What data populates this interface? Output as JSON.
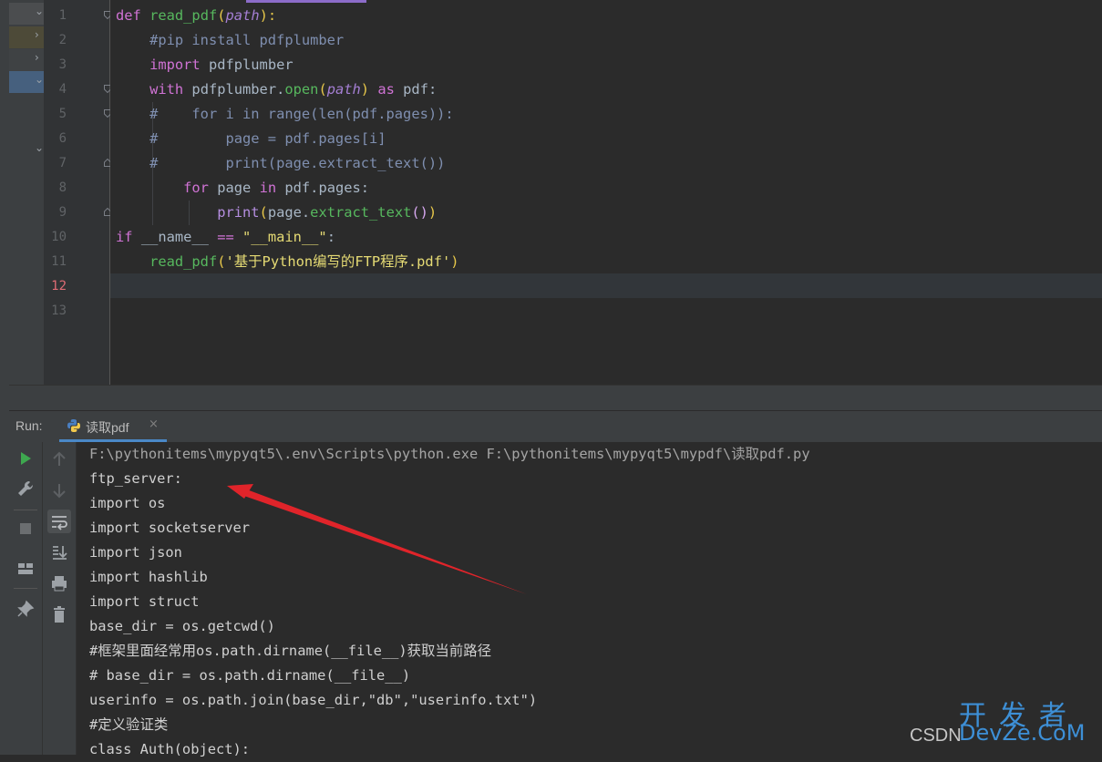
{
  "editor": {
    "current_line": 12,
    "line_numbers": [
      "1",
      "2",
      "3",
      "4",
      "5",
      "6",
      "7",
      "8",
      "9",
      "10",
      "11",
      "12",
      "13"
    ],
    "code": {
      "l1_kw": "def",
      "l1_fn": "read_pdf",
      "l1_open": "(",
      "l1_param": "path",
      "l1_close": "):",
      "l2_comment": "#pip install pdfplumber",
      "l3_kw": "import",
      "l3_rest": " pdfplumber",
      "l4_kw": "with",
      "l4_obj": " pdfplumber.",
      "l4_fn": "open",
      "l4_open": "(",
      "l4_param": "path",
      "l4_close": ")",
      "l4_as": " as",
      "l4_rest": " pdf:",
      "l5_comment": "#    for i in range(len(pdf.pages)):",
      "l6_comment": "#        page = pdf.pages[i]",
      "l7_comment": "#        print(page.extract_text())",
      "l8_kw": "for",
      "l8_mid": " page ",
      "l8_in": "in",
      "l8_rest": " pdf.pages:",
      "l9_fn": "print",
      "l9_open": "(",
      "l9_mid": "page.",
      "l9_call": "extract_text",
      "l9_parens": "()",
      "l9_close": ")",
      "l10_kw": "if",
      "l10_mid": " __name__ ",
      "l10_op": "==",
      "l10_str": " \"__main__\"",
      "l10_colon": ":",
      "l11_fn": "read_pdf",
      "l11_open": "(",
      "l11_str": "'基于Python编写的FTP程序.pdf'",
      "l11_close": ")"
    }
  },
  "run_panel": {
    "label": "Run:",
    "tab_label": "读取pdf",
    "tab_close": "×",
    "tab_icon": "python-icon",
    "console_lines": [
      "F:\\pythonitems\\mypyqt5\\.env\\Scripts\\python.exe F:\\pythonitems\\mypyqt5\\mypdf\\读取pdf.py",
      "ftp_server:",
      "import os",
      "import socketserver",
      "import json",
      "import hashlib",
      "import struct",
      "base_dir = os.getcwd()",
      "#框架里面经常用os.path.dirname(__file__)获取当前路径",
      "# base_dir = os.path.dirname(__file__)",
      "userinfo = os.path.join(base_dir,\"db\",\"userinfo.txt\")",
      "#定义验证类",
      "class Auth(object):"
    ],
    "toolbar_icons": [
      "rerun-icon",
      "wrench-icon",
      "stop-icon",
      "layout-icon",
      "pin-icon"
    ],
    "toolbar2_icons": [
      "scroll-up-icon",
      "scroll-down-icon",
      "soft-wrap-icon",
      "scroll-to-end-icon",
      "print-icon",
      "trash-icon"
    ]
  },
  "watermark": {
    "cn": "开发者",
    "csdn": "CSDN",
    "dev": "DevZe.CoM"
  },
  "colors": {
    "annotation_arrow": "#e0242a",
    "run_green": "#3ea84f"
  }
}
